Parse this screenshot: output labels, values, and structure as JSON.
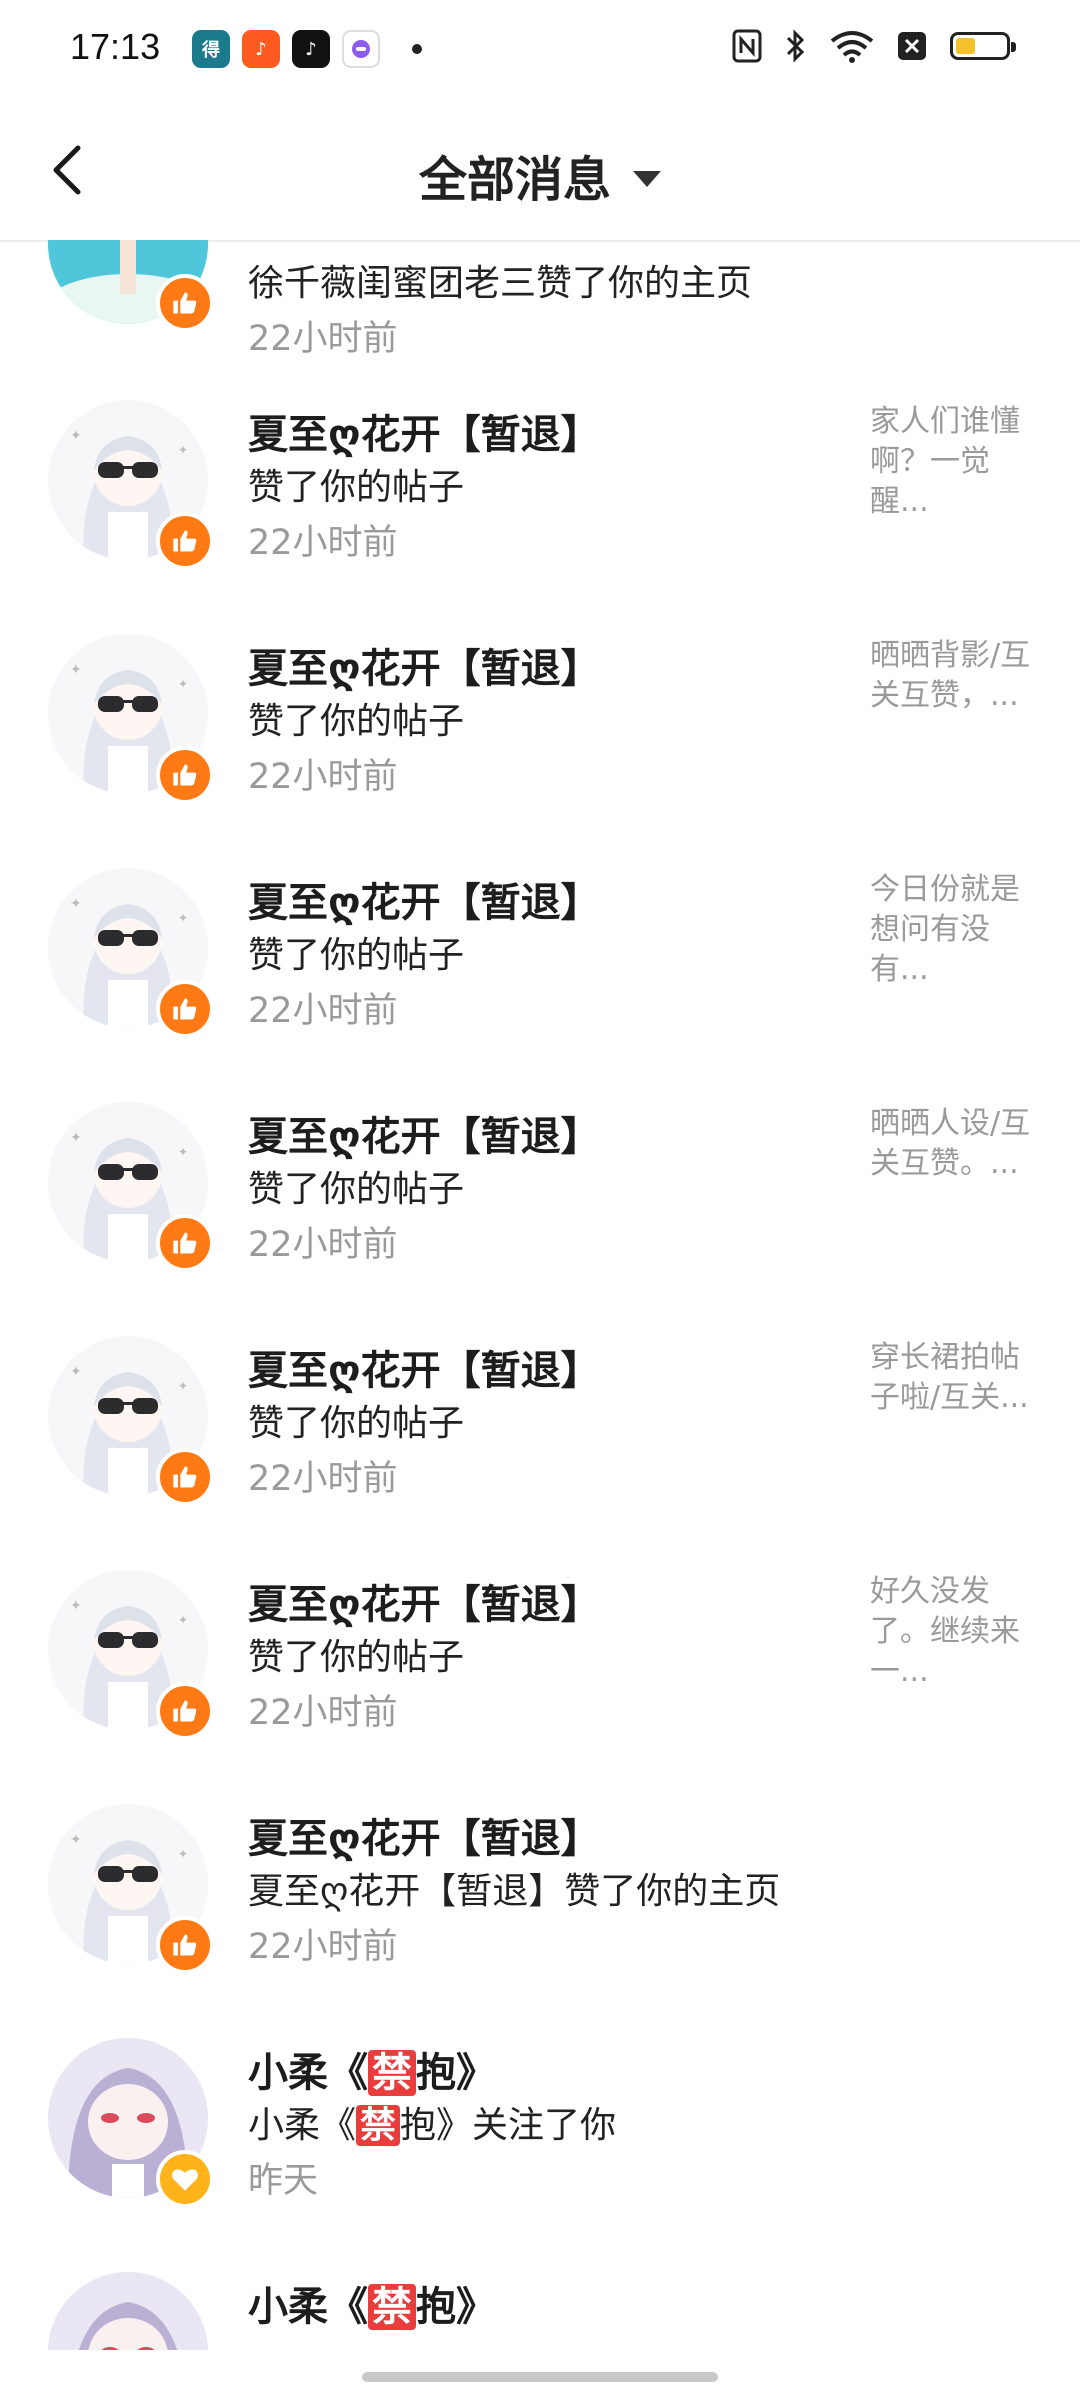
{
  "status_bar": {
    "time": "17:13",
    "app_icons": [
      "notification-app-icon",
      "tiktok-icon",
      "tiktok-icon",
      "chat-bubble-icon"
    ]
  },
  "header": {
    "title": "全部消息"
  },
  "messages": [
    {
      "name": "",
      "action": "徐千薇闺蜜团老三赞了你的主页",
      "time": "22小时前",
      "preview": "",
      "badge": "like"
    },
    {
      "name": "夏至ღ花开【暂退】",
      "action": "赞了你的帖子",
      "time": "22小时前",
      "preview": "家人们谁懂啊？一觉醒...",
      "badge": "like"
    },
    {
      "name": "夏至ღ花开【暂退】",
      "action": "赞了你的帖子",
      "time": "22小时前",
      "preview": "晒晒背影/互关互赞，...",
      "badge": "like"
    },
    {
      "name": "夏至ღ花开【暂退】",
      "action": "赞了你的帖子",
      "time": "22小时前",
      "preview": "今日份就是想问有没有...",
      "badge": "like"
    },
    {
      "name": "夏至ღ花开【暂退】",
      "action": "赞了你的帖子",
      "time": "22小时前",
      "preview": "晒晒人设/互关互赞。...",
      "badge": "like"
    },
    {
      "name": "夏至ღ花开【暂退】",
      "action": "赞了你的帖子",
      "time": "22小时前",
      "preview": "穿长裙拍帖子啦/互关...",
      "badge": "like"
    },
    {
      "name": "夏至ღ花开【暂退】",
      "action": "赞了你的帖子",
      "time": "22小时前",
      "preview": "好久没发了。继续来一...",
      "badge": "like"
    },
    {
      "name": "夏至ღ花开【暂退】",
      "action": "夏至ღ花开【暂退】赞了你的主页",
      "time": "22小时前",
      "preview": "",
      "badge": "like"
    },
    {
      "name_pre": "小柔《",
      "name_ban": "禁",
      "name_post": "抱》",
      "action_pre": "小柔《",
      "action_ban": "禁",
      "action_post": "抱》关注了你",
      "time": "昨天",
      "badge": "follow"
    },
    {
      "name_pre": "小柔《",
      "name_ban": "禁",
      "name_post": "抱》"
    }
  ]
}
